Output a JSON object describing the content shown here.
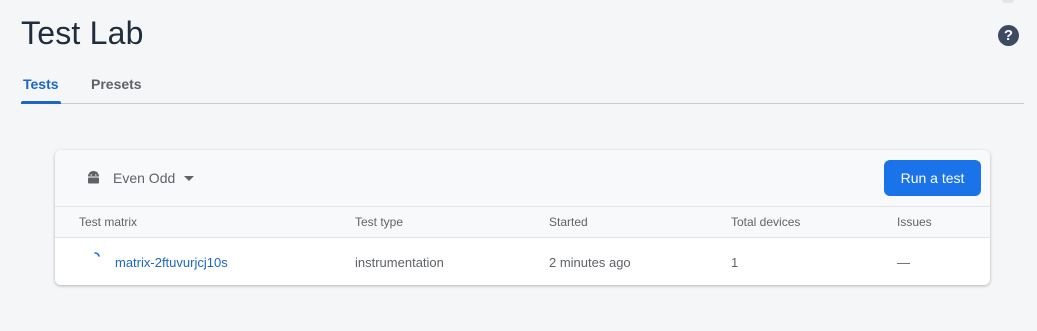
{
  "page": {
    "title": "Test Lab",
    "help_icon": "help-circle-icon",
    "help_glyph": "?"
  },
  "tabs": [
    {
      "label": "Tests",
      "active": true
    },
    {
      "label": "Presets",
      "active": false
    }
  ],
  "card": {
    "app_icon": "android-icon",
    "app_name": "Even Odd",
    "run_button_label": "Run a test",
    "columns": [
      "Test matrix",
      "Test type",
      "Started",
      "Total devices",
      "Issues"
    ],
    "rows": [
      {
        "status_icon": "spinner-icon",
        "matrix": "matrix-2ftuvurjcj10s",
        "test_type": "instrumentation",
        "started": "2 minutes ago",
        "total_devices": "1",
        "issues": "—"
      }
    ]
  },
  "colors": {
    "accent": "#1a73e8",
    "link": "#1a66c8",
    "title": "#1f2d3d",
    "background": "#f5f6f8"
  }
}
